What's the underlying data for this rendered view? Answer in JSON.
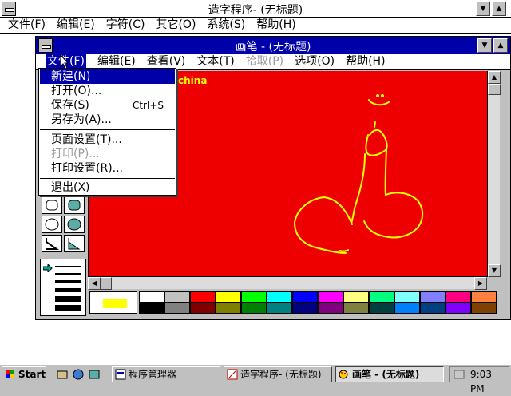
{
  "outer_window": {
    "title": "造字程序- (无标题)",
    "menu": [
      "文件(F)",
      "编辑(E)",
      "字符(C)",
      "其它(O)",
      "系统(S)",
      "帮助(H)"
    ]
  },
  "paint_window": {
    "title": "画笔 - (无标题)",
    "menu": [
      "文件(F)",
      "编辑(E)",
      "查看(V)",
      "文本(T)",
      "拾取(P)",
      "选项(O)",
      "帮助(H)"
    ],
    "canvas_text": "china",
    "canvas_color": "#ee0000",
    "stroke_color": "#ffff00",
    "foreground_color": "#ffff00",
    "palette": [
      "#ffffff",
      "#c0c0c0",
      "#ff0000",
      "#ffff00",
      "#00ff00",
      "#00ffff",
      "#0000ff",
      "#ff00ff",
      "#ffff80",
      "#00ff80",
      "#80ffff",
      "#8080ff",
      "#ff0080",
      "#ff8040",
      "#000000",
      "#808080",
      "#800000",
      "#808000",
      "#008000",
      "#008080",
      "#000080",
      "#800080",
      "#808040",
      "#004040",
      "#0080ff",
      "#004080",
      "#8000ff",
      "#804000"
    ]
  },
  "file_menu": {
    "items": [
      {
        "label": "新建(N)",
        "accel": "",
        "selected": true,
        "disabled": false
      },
      {
        "label": "打开(O)...",
        "accel": "",
        "selected": false,
        "disabled": false
      },
      {
        "label": "保存(S)",
        "accel": "Ctrl+S",
        "selected": false,
        "disabled": false
      },
      {
        "label": "另存为(A)...",
        "accel": "",
        "selected": false,
        "disabled": false
      },
      {
        "label": "页面设置(T)...",
        "accel": "",
        "selected": false,
        "disabled": false
      },
      {
        "label": "打印(P)...",
        "accel": "",
        "selected": false,
        "disabled": true
      },
      {
        "label": "打印设置(R)...",
        "accel": "",
        "selected": false,
        "disabled": false
      },
      {
        "label": "退出(X)",
        "accel": "",
        "selected": false,
        "disabled": false
      }
    ]
  },
  "taskbar": {
    "start": "Start",
    "tasks": [
      "程序管理器",
      "造字程序- (无标题)",
      "画笔 - (无标题)"
    ],
    "clock": "9:03 PM"
  }
}
